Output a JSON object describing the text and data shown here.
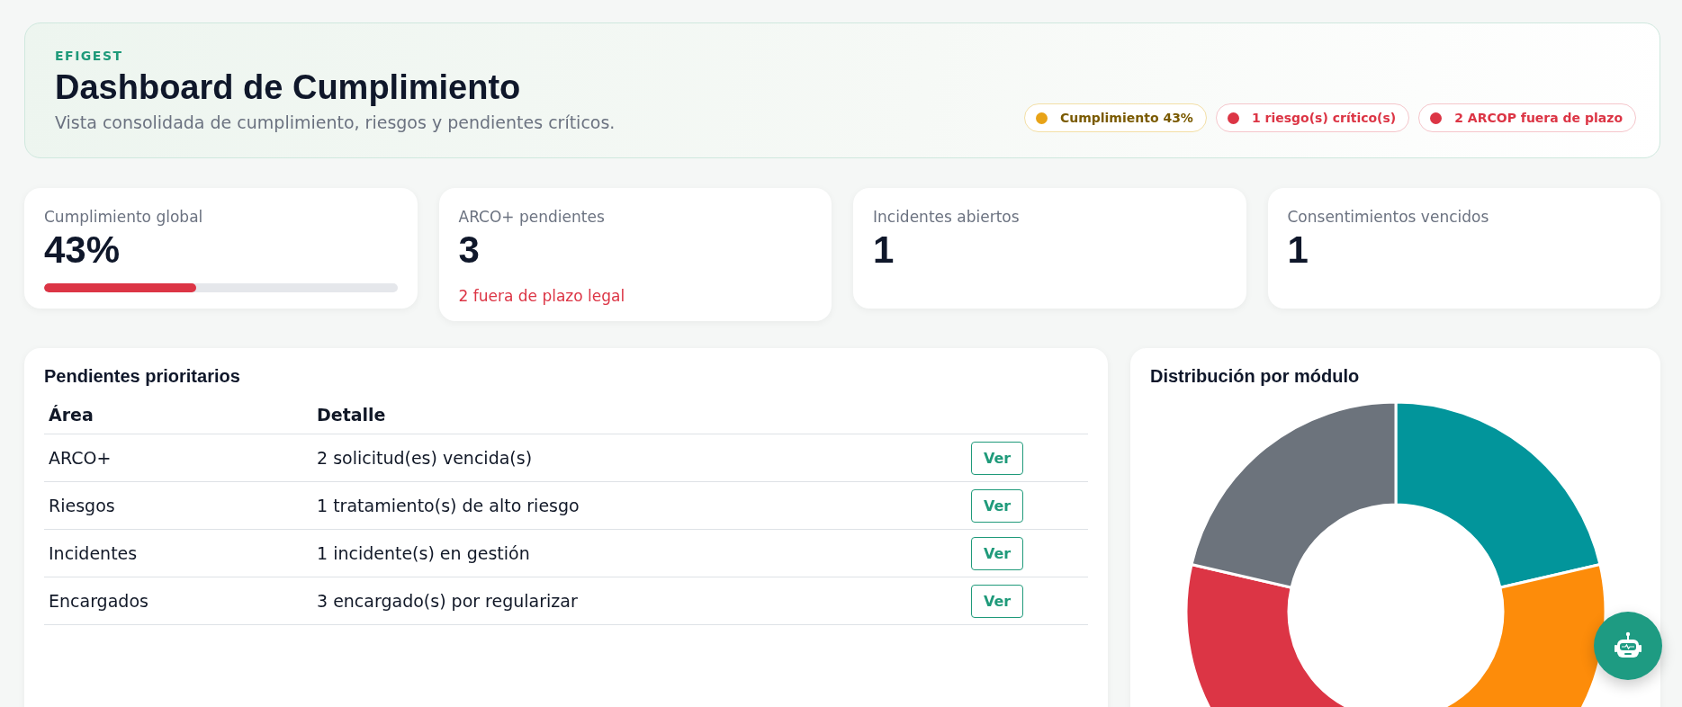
{
  "header": {
    "brand": "EFIGEST",
    "title": "Dashboard de Cumplimiento",
    "subtitle": "Vista consolidada de cumplimiento, riesgos y pendientes críticos.",
    "badges": [
      {
        "label": "Cumplimiento 43%",
        "color": "#e8a317"
      },
      {
        "label": "1 riesgo(s) crítico(s)",
        "color": "#dc3545"
      },
      {
        "label": "2 ARCOP fuera de plazo",
        "color": "#dc3545"
      }
    ]
  },
  "kpis": [
    {
      "label": "Cumplimiento global",
      "value": "43%",
      "level": 0.43
    },
    {
      "label": "ARCO+ pendientes",
      "value": "3",
      "note": "2 fuera de plazo legal"
    },
    {
      "label": "Incidentes abiertos",
      "value": "1"
    },
    {
      "label": "Consentimientos vencidos",
      "value": "1"
    }
  ],
  "pending": {
    "title": "Pendientes prioritarios",
    "columns": [
      "Área",
      "Detalle"
    ],
    "rows": [
      {
        "area": "ARCO+",
        "detail": "2 solicitud(es) vencida(s)",
        "action": "Ver"
      },
      {
        "area": "Riesgos",
        "detail": "1 tratamiento(s) de alto riesgo",
        "action": "Ver"
      },
      {
        "area": "Incidentes",
        "detail": "1 incidente(s) en gestión",
        "action": "Ver"
      },
      {
        "area": "Encargados",
        "detail": "3 encargado(s) por regularizar",
        "action": "Ver"
      }
    ]
  },
  "distribution": {
    "title": "Distribución por módulo"
  }
}
